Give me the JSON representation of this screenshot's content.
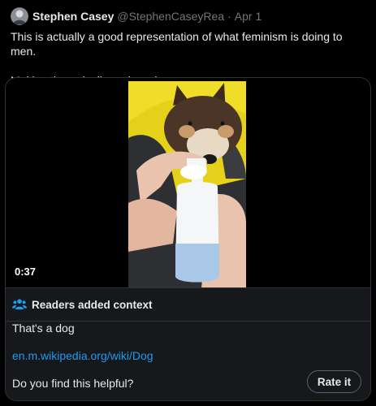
{
  "tweet": {
    "author_name": "Stephen Casey",
    "author_handle": "@StephenCaseyRea",
    "separator": "·",
    "date": "Apr 1",
    "text_line1": "This is actually a good representation of what feminism is doing to men.",
    "text_line2": "Making them docile and weak."
  },
  "media": {
    "duration": "0:37"
  },
  "note": {
    "title": "Readers added context",
    "text": "That's a dog",
    "link": "en.m.wikipedia.org/wiki/Dog",
    "helpful_question": "Do you find this helpful?",
    "rate_label": "Rate it",
    "icon": "people-icon"
  },
  "colors": {
    "background": "#000000",
    "text": "#e7e9ea",
    "muted": "#71767b",
    "link": "#1d9bf0",
    "note_bg": "#16181c",
    "border": "#2f3336"
  }
}
